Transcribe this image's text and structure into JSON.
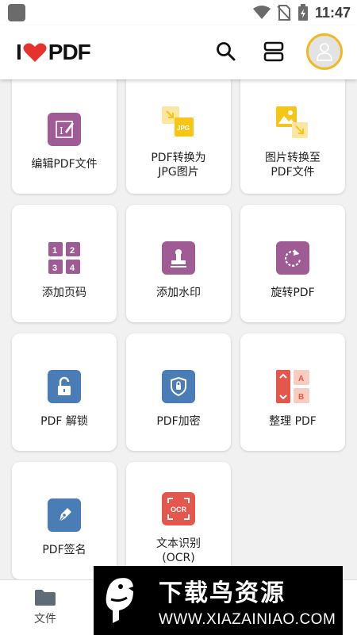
{
  "status_bar": {
    "time": "11:47"
  },
  "header": {
    "logo_left": "I",
    "logo_right": "PDF",
    "logo_accent_color": "#e5322d"
  },
  "tools": [
    {
      "label": "编辑PDF文件",
      "icon": "edit-pdf-icon",
      "color": "#9e5b94"
    },
    {
      "label": "PDF转换为\nJPG图片",
      "icon": "pdf-to-jpg-icon",
      "color": "#f5c518"
    },
    {
      "label": "图片转换至\nPDF文件",
      "icon": "jpg-to-pdf-icon",
      "color": "#f5c518"
    },
    {
      "label": "添加页码",
      "icon": "page-numbers-icon",
      "color": "#9e5b94"
    },
    {
      "label": "添加水印",
      "icon": "watermark-stamp-icon",
      "color": "#9e5b94"
    },
    {
      "label": "旋转PDF",
      "icon": "rotate-icon",
      "color": "#9e5b94"
    },
    {
      "label": "PDF 解锁",
      "icon": "unlock-icon",
      "color": "#4a7cb5"
    },
    {
      "label": "PDF加密",
      "icon": "protect-shield-icon",
      "color": "#4a7cb5"
    },
    {
      "label": "整理 PDF",
      "icon": "organize-icon",
      "color": "#e3574c"
    },
    {
      "label": "PDF签名",
      "icon": "sign-pen-icon",
      "color": "#4a7cb5"
    },
    {
      "label": "文本识别\n(OCR)",
      "icon": "ocr-icon",
      "color": "#e3574c"
    }
  ],
  "bottom_nav": {
    "files_label": "文件"
  },
  "watermark": {
    "title": "下载鸟资源",
    "url": "WWW.XIAZAINIAO.COM"
  }
}
